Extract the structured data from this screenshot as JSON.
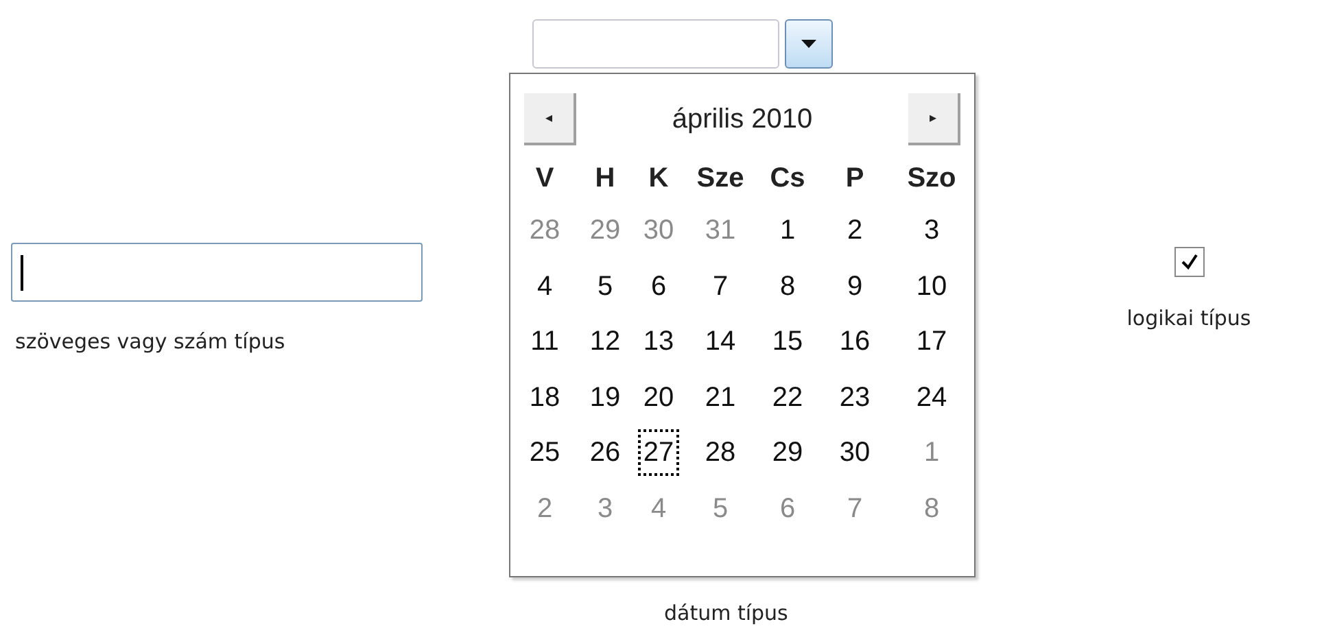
{
  "text_field": {
    "focused": true,
    "label": "szöveges vagy szám típus"
  },
  "date_field": {
    "label": "dátum típus"
  },
  "calendar": {
    "prev": "◂",
    "next": "▸",
    "month": "április 2010",
    "weekdays": [
      "V",
      "H",
      "K",
      "Sze",
      "Cs",
      "P",
      "Szo"
    ],
    "weeks": [
      [
        {
          "day": "28",
          "other": true,
          "selected": false
        },
        {
          "day": "29",
          "other": true,
          "selected": false
        },
        {
          "day": "30",
          "other": true,
          "selected": false
        },
        {
          "day": "31",
          "other": true,
          "selected": false
        },
        {
          "day": "1",
          "other": false,
          "selected": false
        },
        {
          "day": "2",
          "other": false,
          "selected": false
        },
        {
          "day": "3",
          "other": false,
          "selected": false
        }
      ],
      [
        {
          "day": "4",
          "other": false,
          "selected": false
        },
        {
          "day": "5",
          "other": false,
          "selected": false
        },
        {
          "day": "6",
          "other": false,
          "selected": false
        },
        {
          "day": "7",
          "other": false,
          "selected": false
        },
        {
          "day": "8",
          "other": false,
          "selected": false
        },
        {
          "day": "9",
          "other": false,
          "selected": false
        },
        {
          "day": "10",
          "other": false,
          "selected": false
        }
      ],
      [
        {
          "day": "11",
          "other": false,
          "selected": false
        },
        {
          "day": "12",
          "other": false,
          "selected": false
        },
        {
          "day": "13",
          "other": false,
          "selected": false
        },
        {
          "day": "14",
          "other": false,
          "selected": false
        },
        {
          "day": "15",
          "other": false,
          "selected": false
        },
        {
          "day": "16",
          "other": false,
          "selected": false
        },
        {
          "day": "17",
          "other": false,
          "selected": false
        }
      ],
      [
        {
          "day": "18",
          "other": false,
          "selected": false
        },
        {
          "day": "19",
          "other": false,
          "selected": false
        },
        {
          "day": "20",
          "other": false,
          "selected": false
        },
        {
          "day": "21",
          "other": false,
          "selected": false
        },
        {
          "day": "22",
          "other": false,
          "selected": false
        },
        {
          "day": "23",
          "other": false,
          "selected": false
        },
        {
          "day": "24",
          "other": false,
          "selected": false
        }
      ],
      [
        {
          "day": "25",
          "other": false,
          "selected": false
        },
        {
          "day": "26",
          "other": false,
          "selected": false
        },
        {
          "day": "27",
          "other": false,
          "selected": true
        },
        {
          "day": "28",
          "other": false,
          "selected": false
        },
        {
          "day": "29",
          "other": false,
          "selected": false
        },
        {
          "day": "30",
          "other": false,
          "selected": false
        },
        {
          "day": "1",
          "other": true,
          "selected": false
        }
      ],
      [
        {
          "day": "2",
          "other": true,
          "selected": false
        },
        {
          "day": "3",
          "other": true,
          "selected": false
        },
        {
          "day": "4",
          "other": true,
          "selected": false
        },
        {
          "day": "5",
          "other": true,
          "selected": false
        },
        {
          "day": "6",
          "other": true,
          "selected": false
        },
        {
          "day": "7",
          "other": true,
          "selected": false
        },
        {
          "day": "8",
          "other": true,
          "selected": false
        }
      ]
    ]
  },
  "checkbox": {
    "checked": true,
    "label": "logikai típus"
  }
}
